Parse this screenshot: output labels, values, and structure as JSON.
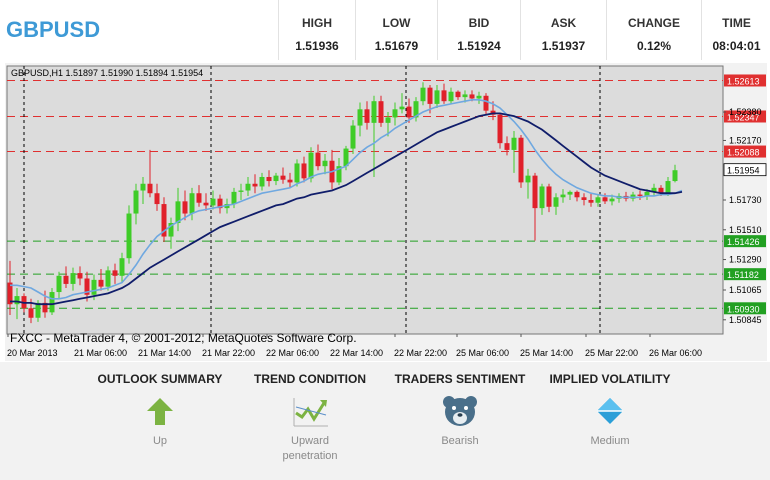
{
  "header": {
    "symbol": "GBPUSD",
    "stats": [
      {
        "label": "HIGH",
        "value": "1.51936"
      },
      {
        "label": "LOW",
        "value": "1.51679"
      },
      {
        "label": "BID",
        "value": "1.51924"
      },
      {
        "label": "ASK",
        "value": "1.51937"
      },
      {
        "label": "CHANGE",
        "value": "0.12%"
      },
      {
        "label": "TIME",
        "value": "08:04:01"
      }
    ]
  },
  "chart_data": {
    "type": "candlestick",
    "info_line": "GBPUSD,H1  1.51897 1.51990 1.51894 1.51954",
    "copyright": "FXCC - MetaTrader 4, © 2001-2012, MetaQuotes Software Corp.",
    "ylim": [
      1.5074,
      1.5272
    ],
    "y_ticks": [
      "1.52380",
      "1.52170",
      "1.51730",
      "1.51510",
      "1.51290",
      "1.51065",
      "1.50845"
    ],
    "x_ticks": [
      "20 Mar 2013",
      "21 Mar 06:00",
      "21 Mar 14:00",
      "21 Mar 22:00",
      "22 Mar 06:00",
      "22 Mar 14:00",
      "22 Mar 22:00",
      "25 Mar 06:00",
      "25 Mar 14:00",
      "25 Mar 22:00",
      "26 Mar 06:00"
    ],
    "current_price": "1.51954",
    "levels": [
      {
        "value": "1.52613",
        "color": "#e03030"
      },
      {
        "value": "1.52347",
        "color": "#e03030"
      },
      {
        "value": "1.52088",
        "color": "#e03030"
      },
      {
        "value": "1.51426",
        "color": "#22a022"
      },
      {
        "value": "1.51182",
        "color": "#22a022"
      },
      {
        "value": "1.50930",
        "color": "#22a022"
      }
    ],
    "colors": {
      "bull": "#3fcc28",
      "bear": "#e0202a",
      "ma_fast": "#6fa8e0",
      "ma_slow": "#101d6a"
    },
    "candles": [
      [
        1.5112,
        1.5128,
        1.5088,
        1.5096
      ],
      [
        1.5096,
        1.5108,
        1.5085,
        1.5102
      ],
      [
        1.5102,
        1.5104,
        1.509,
        1.5093
      ],
      [
        1.5093,
        1.51,
        1.5082,
        1.5086
      ],
      [
        1.5086,
        1.5099,
        1.5083,
        1.5097
      ],
      [
        1.5097,
        1.5106,
        1.5086,
        1.509
      ],
      [
        1.509,
        1.5108,
        1.5088,
        1.5105
      ],
      [
        1.5105,
        1.512,
        1.51,
        1.5117
      ],
      [
        1.5117,
        1.5124,
        1.5108,
        1.5111
      ],
      [
        1.5111,
        1.5123,
        1.5106,
        1.5119
      ],
      [
        1.5119,
        1.5124,
        1.511,
        1.5115
      ],
      [
        1.5115,
        1.512,
        1.5098,
        1.5103
      ],
      [
        1.5103,
        1.5118,
        1.5099,
        1.5114
      ],
      [
        1.5114,
        1.5122,
        1.5106,
        1.5109
      ],
      [
        1.5109,
        1.5124,
        1.5106,
        1.5121
      ],
      [
        1.5121,
        1.5126,
        1.5111,
        1.5117
      ],
      [
        1.5117,
        1.5134,
        1.5112,
        1.513
      ],
      [
        1.513,
        1.5169,
        1.5126,
        1.5163
      ],
      [
        1.5163,
        1.5185,
        1.5155,
        1.518
      ],
      [
        1.518,
        1.519,
        1.517,
        1.5185
      ],
      [
        1.5185,
        1.521,
        1.5175,
        1.5178
      ],
      [
        1.5178,
        1.5185,
        1.5165,
        1.517
      ],
      [
        1.517,
        1.5175,
        1.5142,
        1.5146
      ],
      [
        1.5146,
        1.516,
        1.5137,
        1.5156
      ],
      [
        1.5156,
        1.5182,
        1.515,
        1.5172
      ],
      [
        1.5172,
        1.518,
        1.5158,
        1.5163
      ],
      [
        1.5163,
        1.5182,
        1.5158,
        1.5178
      ],
      [
        1.5178,
        1.5184,
        1.5168,
        1.5171
      ],
      [
        1.5171,
        1.5178,
        1.5165,
        1.5169
      ],
      [
        1.5169,
        1.518,
        1.5166,
        1.5174
      ],
      [
        1.5174,
        1.5177,
        1.5163,
        1.5167
      ],
      [
        1.5167,
        1.5174,
        1.5163,
        1.517
      ],
      [
        1.517,
        1.5182,
        1.5167,
        1.5179
      ],
      [
        1.5179,
        1.5185,
        1.5173,
        1.518
      ],
      [
        1.518,
        1.519,
        1.5176,
        1.5185
      ],
      [
        1.5185,
        1.5192,
        1.5178,
        1.5183
      ],
      [
        1.5183,
        1.5193,
        1.518,
        1.519
      ],
      [
        1.519,
        1.5195,
        1.5183,
        1.5187
      ],
      [
        1.5187,
        1.5193,
        1.5184,
        1.5191
      ],
      [
        1.5191,
        1.5197,
        1.5185,
        1.5188
      ],
      [
        1.5188,
        1.5193,
        1.5182,
        1.5186
      ],
      [
        1.5186,
        1.5203,
        1.5183,
        1.52
      ],
      [
        1.52,
        1.5205,
        1.5186,
        1.5189
      ],
      [
        1.5189,
        1.5212,
        1.5186,
        1.5208
      ],
      [
        1.5208,
        1.5214,
        1.5195,
        1.5198
      ],
      [
        1.5198,
        1.5207,
        1.5192,
        1.5202
      ],
      [
        1.5202,
        1.521,
        1.5181,
        1.5186
      ],
      [
        1.5186,
        1.5204,
        1.5184,
        1.5198
      ],
      [
        1.5198,
        1.5213,
        1.5195,
        1.5211
      ],
      [
        1.5211,
        1.5232,
        1.5207,
        1.5228
      ],
      [
        1.5228,
        1.5245,
        1.522,
        1.524
      ],
      [
        1.524,
        1.5246,
        1.5225,
        1.523
      ],
      [
        1.523,
        1.525,
        1.519,
        1.5246
      ],
      [
        1.5246,
        1.525,
        1.5227,
        1.523
      ],
      [
        1.523,
        1.5238,
        1.522,
        1.5234
      ],
      [
        1.5234,
        1.5245,
        1.5228,
        1.524
      ],
      [
        1.524,
        1.5252,
        1.5237,
        1.5242
      ],
      [
        1.5242,
        1.5248,
        1.523,
        1.5234
      ],
      [
        1.5234,
        1.5249,
        1.5231,
        1.5246
      ],
      [
        1.5246,
        1.526,
        1.5243,
        1.5256
      ],
      [
        1.5256,
        1.5258,
        1.5237,
        1.5244
      ],
      [
        1.5244,
        1.5258,
        1.5241,
        1.5254
      ],
      [
        1.5254,
        1.5259,
        1.5244,
        1.5246
      ],
      [
        1.5246,
        1.5256,
        1.5244,
        1.5253
      ],
      [
        1.5253,
        1.5254,
        1.5247,
        1.5249
      ],
      [
        1.5249,
        1.5254,
        1.5245,
        1.5251
      ],
      [
        1.5251,
        1.5254,
        1.5246,
        1.5248
      ],
      [
        1.5248,
        1.5253,
        1.5244,
        1.525
      ],
      [
        1.525,
        1.5252,
        1.5236,
        1.5239
      ],
      [
        1.5239,
        1.5246,
        1.5232,
        1.5236
      ],
      [
        1.5236,
        1.5237,
        1.5211,
        1.5215
      ],
      [
        1.5215,
        1.522,
        1.5206,
        1.521
      ],
      [
        1.521,
        1.5224,
        1.5193,
        1.5219
      ],
      [
        1.5219,
        1.5221,
        1.5182,
        1.5186
      ],
      [
        1.5186,
        1.5196,
        1.5174,
        1.5191
      ],
      [
        1.5191,
        1.5193,
        1.5143,
        1.5167
      ],
      [
        1.5167,
        1.5185,
        1.5162,
        1.5183
      ],
      [
        1.5183,
        1.5185,
        1.5164,
        1.5168
      ],
      [
        1.5168,
        1.5178,
        1.5162,
        1.5175
      ],
      [
        1.5175,
        1.5181,
        1.5171,
        1.5177
      ],
      [
        1.5177,
        1.518,
        1.5173,
        1.5179
      ],
      [
        1.5179,
        1.518,
        1.5172,
        1.5175
      ],
      [
        1.5175,
        1.5178,
        1.5169,
        1.5173
      ],
      [
        1.5173,
        1.5178,
        1.5168,
        1.5171
      ],
      [
        1.5171,
        1.5177,
        1.5168,
        1.5175
      ],
      [
        1.5175,
        1.5178,
        1.517,
        1.5172
      ],
      [
        1.5172,
        1.5177,
        1.5169,
        1.5174
      ],
      [
        1.5174,
        1.5178,
        1.5171,
        1.5176
      ],
      [
        1.5176,
        1.5179,
        1.5172,
        1.5174
      ],
      [
        1.5174,
        1.5179,
        1.5172,
        1.5177
      ],
      [
        1.5177,
        1.518,
        1.5173,
        1.5176
      ],
      [
        1.5176,
        1.5181,
        1.5173,
        1.5179
      ],
      [
        1.5179,
        1.5185,
        1.5176,
        1.5182
      ],
      [
        1.5182,
        1.5184,
        1.5176,
        1.5178
      ],
      [
        1.5178,
        1.519,
        1.5176,
        1.5187
      ],
      [
        1.5187,
        1.5199,
        1.5186,
        1.5195
      ]
    ],
    "ma_fast": [
      1.511,
      1.511,
      1.5109,
      1.5108,
      1.5105,
      1.5102,
      1.51,
      1.51,
      1.5101,
      1.5103,
      1.5104,
      1.5105,
      1.5106,
      1.5107,
      1.5108,
      1.511,
      1.5112,
      1.5118,
      1.5125,
      1.5133,
      1.514,
      1.5146,
      1.515,
      1.5154,
      1.5157,
      1.516,
      1.5163,
      1.5165,
      1.5166,
      1.5167,
      1.5168,
      1.5169,
      1.517,
      1.5172,
      1.5174,
      1.5176,
      1.5178,
      1.5179,
      1.518,
      1.5181,
      1.5182,
      1.5185,
      1.5187,
      1.519,
      1.5192,
      1.5193,
      1.5194,
      1.5196,
      1.5198,
      1.5203,
      1.5208,
      1.5212,
      1.5215,
      1.5219,
      1.5222,
      1.5226,
      1.5229,
      1.5232,
      1.5235,
      1.5238,
      1.524,
      1.5242,
      1.5243,
      1.5244,
      1.5245,
      1.5246,
      1.5247,
      1.5247,
      1.5246,
      1.5244,
      1.5241,
      1.5236,
      1.5231,
      1.5225,
      1.5218,
      1.521,
      1.5203,
      1.5197,
      1.5192,
      1.5188,
      1.5185,
      1.5182,
      1.518,
      1.5178,
      1.5177,
      1.5176,
      1.5176,
      1.5175,
      1.5175,
      1.5175,
      1.5175,
      1.5176,
      1.5176,
      1.5177,
      1.5177,
      1.5178,
      1.518
    ],
    "ma_slow": [
      1.5098,
      1.5098,
      1.5097,
      1.5097,
      1.5096,
      1.5096,
      1.5096,
      1.5097,
      1.5098,
      1.5099,
      1.51,
      1.5101,
      1.5102,
      1.5103,
      1.5104,
      1.5106,
      1.5108,
      1.5111,
      1.5115,
      1.5119,
      1.5123,
      1.5126,
      1.5129,
      1.5132,
      1.5135,
      1.5138,
      1.5141,
      1.5144,
      1.5147,
      1.515,
      1.5153,
      1.5155,
      1.5157,
      1.5159,
      1.5161,
      1.5163,
      1.5165,
      1.5167,
      1.5169,
      1.517,
      1.5172,
      1.5174,
      1.5175,
      1.5177,
      1.5178,
      1.5179,
      1.518,
      1.5182,
      1.5184,
      1.5187,
      1.519,
      1.5193,
      1.5196,
      1.5199,
      1.5202,
      1.5205,
      1.5208,
      1.5211,
      1.5214,
      1.5217,
      1.522,
      1.5223,
      1.5225,
      1.5227,
      1.5229,
      1.5231,
      1.5233,
      1.5235,
      1.5236,
      1.5237,
      1.5237,
      1.5236,
      1.5235,
      1.5233,
      1.5231,
      1.5228,
      1.5225,
      1.5221,
      1.5217,
      1.5213,
      1.5209,
      1.5205,
      1.5201,
      1.5197,
      1.5194,
      1.5191,
      1.5189,
      1.5187,
      1.5185,
      1.5183,
      1.5181,
      1.518,
      1.5179,
      1.5178,
      1.5178,
      1.5178,
      1.5179
    ]
  },
  "summary": [
    {
      "title": "OUTLOOK SUMMARY",
      "label": "Up",
      "icon": "up-arrow-icon",
      "color": "#7cb342"
    },
    {
      "title": "TREND CONDITION",
      "label": "Upward\npenetration",
      "icon": "trend-chart-icon",
      "color": "#7cb342"
    },
    {
      "title": "TRADERS SENTIMENT",
      "label": "Bearish",
      "icon": "bear-icon",
      "color": "#4a6f8a"
    },
    {
      "title": "IMPLIED VOLATILITY",
      "label": "Medium",
      "icon": "diamond-icon",
      "color": "#2b9fd8"
    }
  ]
}
